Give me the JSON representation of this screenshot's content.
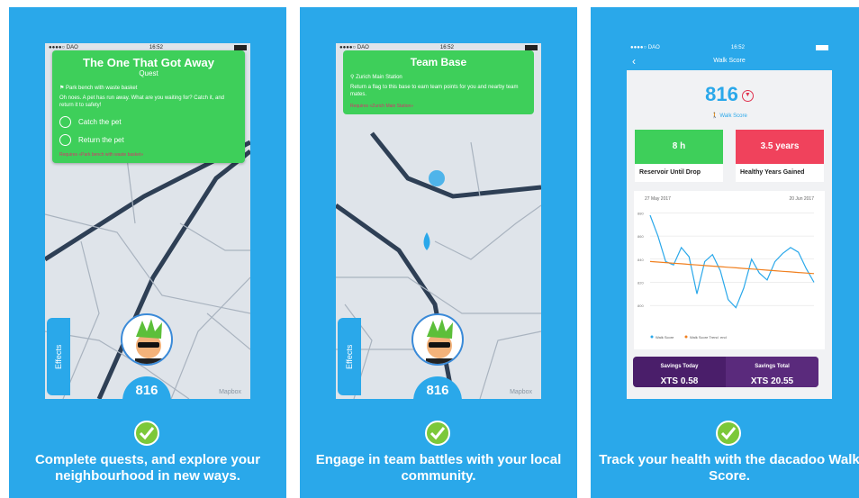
{
  "panels": [
    {
      "status": {
        "carrier": "●●●●○ DAO",
        "time": "16:52"
      },
      "quest": {
        "title": "The One That Got Away",
        "subtitle": "Quest",
        "location": "Park bench with waste basket",
        "description": "Oh noes. A pet has run away. What are you waiting for? Catch it, and return it to safety!",
        "tasks": [
          "Catch the pet",
          "Return the pet"
        ],
        "requires": "Requires «Park bench with waste basket»"
      },
      "effects_label": "Effects",
      "score": "816",
      "mapbox": "Mapbox",
      "caption": "Complete quests, and explore your neighbourhood in new ways."
    },
    {
      "status": {
        "carrier": "●●●●○ DAO",
        "time": "16:52"
      },
      "base": {
        "title": "Team Base",
        "location": "Zurich Main Station",
        "description": "Return a flag to this base to earn team points for you and nearby team mates.",
        "requires": "Requires «Zurich Main Station»"
      },
      "effects_label": "Effects",
      "score": "816",
      "mapbox": "Mapbox",
      "caption": "Engage in team battles with your local community."
    },
    {
      "status": {
        "carrier": "●●●●○ DAO",
        "time": "16:52"
      },
      "nav_title": "Walk Score",
      "score": "816",
      "score_label": "Walk Score",
      "cards": [
        {
          "value": "8 h",
          "label": "Reservoir Until Drop",
          "color": "#3ecf5a"
        },
        {
          "value": "3.5 years",
          "label": "Healthy Years Gained",
          "color": "#f0425c"
        }
      ],
      "savings": [
        {
          "label": "Savings Today",
          "value": "XTS 0.58"
        },
        {
          "label": "Savings Total",
          "value": "XTS 20.55"
        }
      ],
      "caption": "Track your health with the dacadoo Walk Score."
    }
  ],
  "chart_data": {
    "type": "line",
    "x_start_label": "27 May 2017",
    "x_end_label": "20 Jun 2017",
    "y_tick_labels": [
      "880",
      "860",
      "840",
      "820",
      "800"
    ],
    "ylim": [
      790,
      885
    ],
    "series": [
      {
        "name": "Walk Score",
        "color": "#2aa8ea",
        "values": [
          878,
          860,
          838,
          835,
          850,
          842,
          810,
          838,
          844,
          830,
          805,
          798,
          815,
          840,
          828,
          822,
          838,
          845,
          850,
          846,
          832,
          820
        ]
      },
      {
        "name": "Walk Score Trend",
        "color": "#f08020",
        "values": [
          838,
          837.5,
          837,
          836.5,
          836,
          835.5,
          835,
          834.5,
          834,
          833.5,
          833,
          832.5,
          832,
          831.5,
          831,
          830.5,
          830,
          829.5,
          829,
          828.5,
          828,
          827.5
        ]
      }
    ],
    "legend_extra": "end"
  }
}
